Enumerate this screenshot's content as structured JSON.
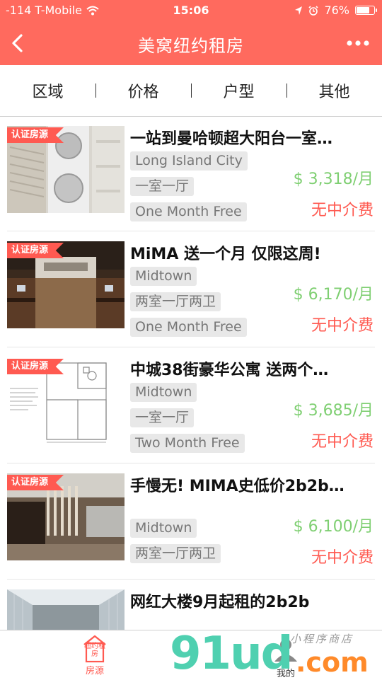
{
  "status_bar": {
    "carrier": "-114 T-Mobile",
    "time": "15:06",
    "battery": "76%",
    "battery_level": 0.76
  },
  "nav": {
    "title": "美窝纽约租房"
  },
  "filters": [
    "区域",
    "价格",
    "户型",
    "其他"
  ],
  "badge_label": "认证房源",
  "listings": [
    {
      "title": "一站到曼哈顿超大阳台一室…",
      "tags": [
        "Long Island City",
        "一室一厅",
        "One Month Free"
      ],
      "price": "$ 3,318/月",
      "fee": "无中介费",
      "image": "laundry-room-photo"
    },
    {
      "title": "MiMA 送一个月 仅限这周!",
      "tags": [
        "Midtown",
        "两室一厅两卫",
        "One Month Free"
      ],
      "price": "$ 6,170/月",
      "fee": "无中介费",
      "image": "lounge-photo"
    },
    {
      "title": "中城38街豪华公寓 送两个…",
      "tags": [
        "Midtown",
        "一室一厅",
        "Two Month Free"
      ],
      "price": "$ 3,685/月",
      "fee": "无中介费",
      "image": "floor-plan"
    },
    {
      "title": "手慢无! MIMA史低价2b2b…",
      "tags": [
        "Midtown",
        "两室一厅两卫"
      ],
      "price": "$ 6,100/月",
      "fee": "无中介费",
      "image": "gym-photo"
    },
    {
      "title": "网红大楼9月起租的2b2b",
      "tags": [],
      "price": "",
      "fee": "",
      "image": "hallway-photo"
    }
  ],
  "tabbar": {
    "home_icon_text": "纽约租房",
    "home_label": "房源",
    "mine_label": "我的"
  },
  "watermark": {
    "brand": "91ud",
    "suffix": ".com",
    "tagline": "小程序商店"
  },
  "colors": {
    "primary": "#ff6a5e",
    "badge": "#ff5a51",
    "price": "#7fcf72",
    "no_fee": "#ff5a51",
    "tag_bg": "#e8e8e8"
  }
}
